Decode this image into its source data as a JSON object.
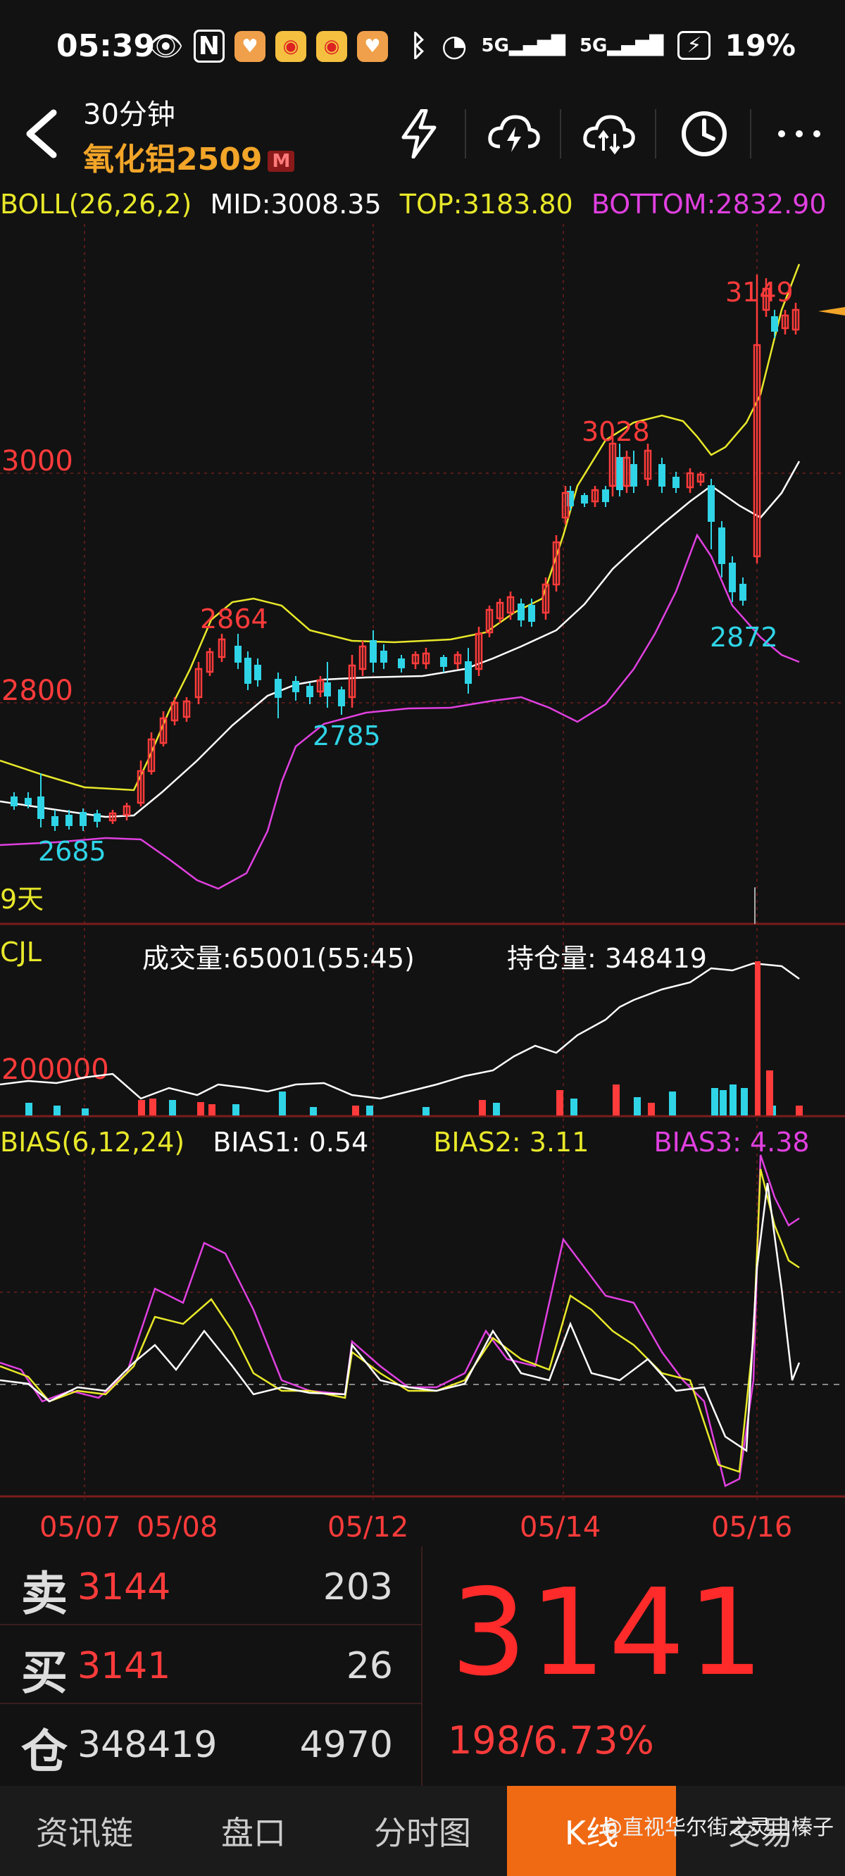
{
  "status": {
    "time": "05:39",
    "battery": "19%",
    "net1": "5G",
    "net2": "5G"
  },
  "header": {
    "period": "30分钟",
    "symbol": "氧化铝2509",
    "badge": "M"
  },
  "boll": {
    "label": "BOLL(26,26,2)",
    "mid": "MID:3008.35",
    "top": "TOP:3183.80",
    "bottom": "BOTTOM:2832.90"
  },
  "chart": {
    "y_labels": [
      "3000",
      "2800"
    ],
    "annotations": {
      "high1": "3149",
      "high2": "3028",
      "high3": "2864",
      "low1": "2872",
      "low2": "2785",
      "low3": "2685"
    },
    "days_label": "9天"
  },
  "cjl": {
    "label": "CJL",
    "volume": "成交量:65001(55:45)",
    "oi": "持仓量: 348419",
    "axis": "200000"
  },
  "bias": {
    "label": "BIAS(6,12,24)",
    "b1": "BIAS1: 0.54",
    "b2": "BIAS2: 3.11",
    "b3": "BIAS3: 4.38"
  },
  "dates": [
    "05/07",
    "05/08",
    "05/12",
    "05/14",
    "05/16"
  ],
  "quote": {
    "sell": {
      "label": "卖",
      "price": "3144",
      "vol": "203"
    },
    "buy": {
      "label": "买",
      "price": "3141",
      "vol": "26"
    },
    "pos": {
      "label": "仓",
      "price": "348419",
      "vol": "4970"
    },
    "last": "3141",
    "change": "198/6.73%"
  },
  "nav": [
    "资讯链",
    "盘口",
    "分时图",
    "K线",
    "交易"
  ],
  "watermark": "@直视华尔街之灵山榛子",
  "colors": {
    "up": "#ff3b3b",
    "down": "#2fd4e6",
    "boll_top": "#e8e82a",
    "boll_mid": "#ffffff",
    "boll_bottom": "#e040e0",
    "accent": "#f06a14"
  }
}
